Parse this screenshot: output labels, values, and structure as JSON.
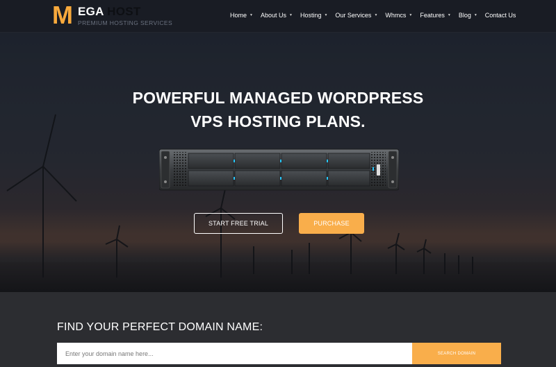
{
  "brand": {
    "logo_letter": "M",
    "logo_word_1": "EGA",
    "logo_word_2": "HOST",
    "tagline": "PREMIUM HOSTING SERVICES",
    "accent_color": "#f9ae4b"
  },
  "nav": {
    "items": [
      {
        "label": "Home",
        "has_dropdown": true
      },
      {
        "label": "About Us",
        "has_dropdown": true
      },
      {
        "label": "Hosting",
        "has_dropdown": true
      },
      {
        "label": "Our Services",
        "has_dropdown": true
      },
      {
        "label": "Whmcs",
        "has_dropdown": true
      },
      {
        "label": "Features",
        "has_dropdown": true
      },
      {
        "label": "Blog",
        "has_dropdown": true
      },
      {
        "label": "Contact Us",
        "has_dropdown": false
      }
    ],
    "dropdown_glyph": "▼"
  },
  "hero": {
    "headline_line_1": "POWERFUL MANAGED WORDPRESS",
    "headline_line_2": "VPS HOSTING PLANS.",
    "trial_button": "START FREE TRIAL",
    "purchase_button": "PURCHASE"
  },
  "domain_search": {
    "title": "FIND YOUR PERFECT DOMAIN NAME:",
    "placeholder": "Enter your domain name here...",
    "value": "",
    "button": "SEARCH DOMAIN"
  }
}
